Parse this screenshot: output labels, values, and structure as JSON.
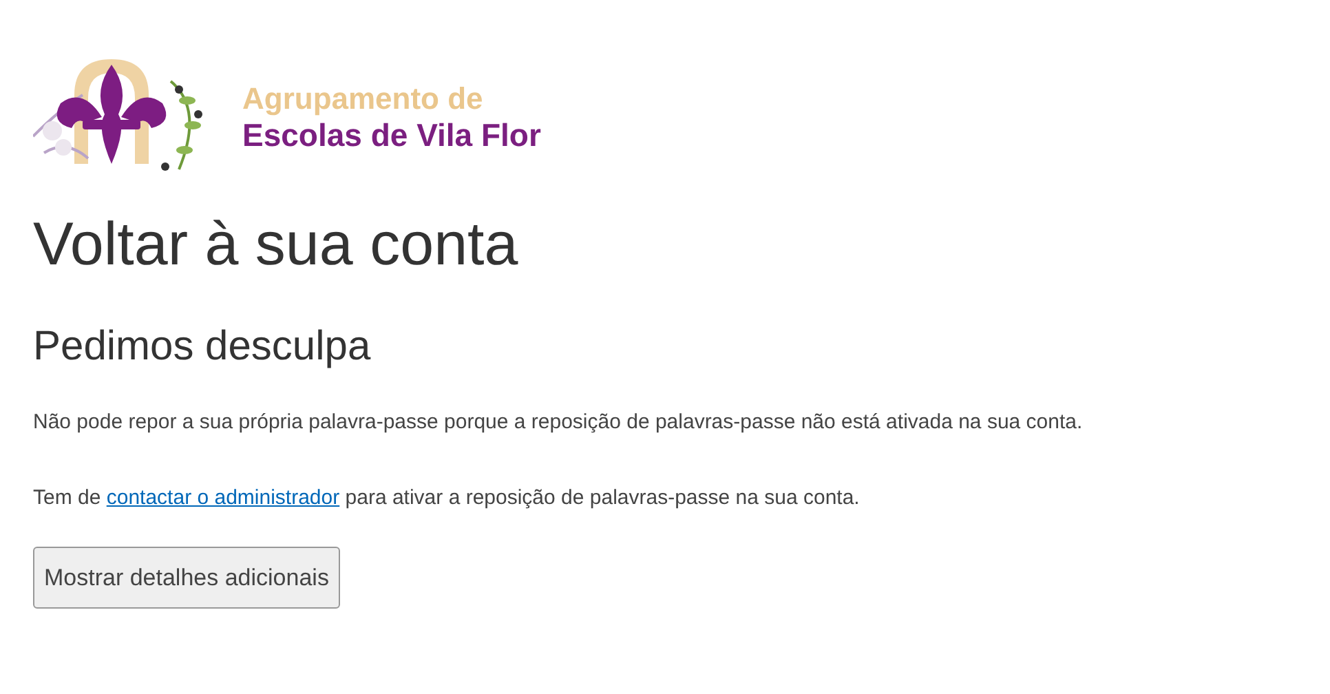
{
  "logo": {
    "line_1": "Agrupamento de",
    "line_2": "Escolas de Vila Flor"
  },
  "title": "Voltar à sua conta",
  "subtitle": "Pedimos desculpa",
  "message": "Não pode repor a sua própria palavra-passe porque a reposição de palavras-passe não está ativada na sua conta.",
  "instruction": {
    "before": "Tem de",
    "link": "contactar o administrador",
    "after": "para ativar a reposição de palavras-passe na sua conta."
  },
  "button": "Mostrar detalhes adicionais"
}
